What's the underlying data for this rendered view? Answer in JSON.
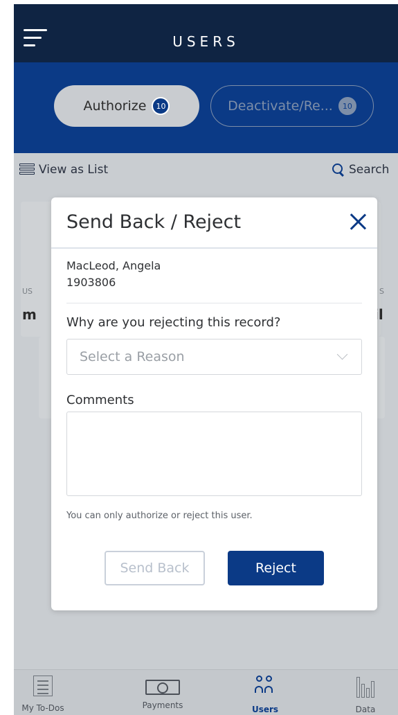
{
  "header": {
    "title": "USERS"
  },
  "segments": {
    "authorize": {
      "label": "Authorize",
      "count": "10"
    },
    "deactivate": {
      "label": "Deactivate/Re...",
      "count": "10"
    }
  },
  "toolbar": {
    "view_as_list": "View as List",
    "search": "Search"
  },
  "background_card": {
    "user_label": "US",
    "user_value": "m",
    "right_label": "S",
    "right_value": "il"
  },
  "modal": {
    "title": "Send Back / Reject",
    "user_name": "MacLeod, Angela",
    "user_id": "1903806",
    "reason_label": "Why are you rejecting this record?",
    "reason_placeholder": "Select a Reason",
    "comments_label": "Comments",
    "helper_text": "You can only authorize or reject this user.",
    "send_back_label": "Send Back",
    "reject_label": "Reject"
  },
  "bottom_nav": {
    "todos": "My To-Dos",
    "payments": "Payments",
    "users": "Users",
    "data": "Data"
  },
  "colors": {
    "header": "#0f2443",
    "brand": "#0b3a86",
    "overlay": "#c9cdd1"
  }
}
